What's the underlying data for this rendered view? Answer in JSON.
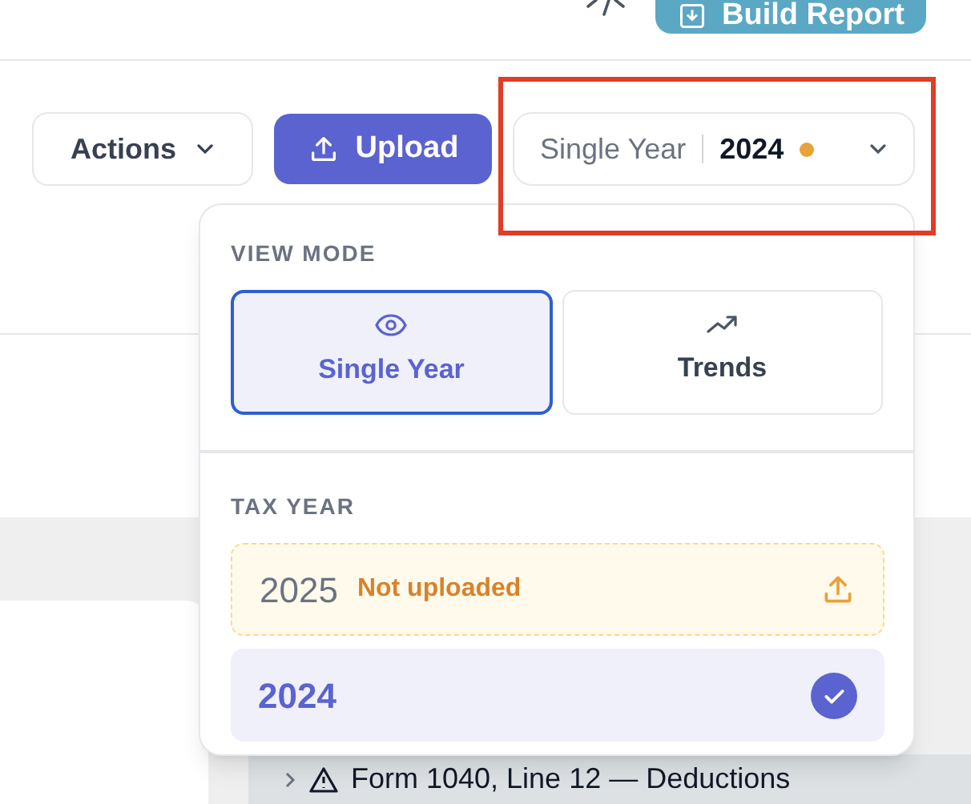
{
  "header": {
    "build_button": "Build Report"
  },
  "toolbar": {
    "actions_button": "Actions",
    "upload_button": "Upload",
    "year_selector": {
      "mode": "Single Year",
      "year": "2024"
    }
  },
  "popover": {
    "sections": [
      {
        "heading": "VIEW MODE",
        "kind": "modes",
        "options": [
          {
            "label": "Single Year",
            "selected": true
          },
          {
            "label": "Trends",
            "selected": false
          }
        ]
      },
      {
        "heading": "TAX YEAR",
        "kind": "years",
        "options": [
          {
            "year": "2025",
            "status": "Not uploaded",
            "uploaded": false,
            "selected": false
          },
          {
            "year": "2024",
            "selected": true
          }
        ]
      }
    ]
  },
  "tree_row": {
    "label": "Form 1040, Line 12 — Deductions",
    "expanded": false
  }
}
